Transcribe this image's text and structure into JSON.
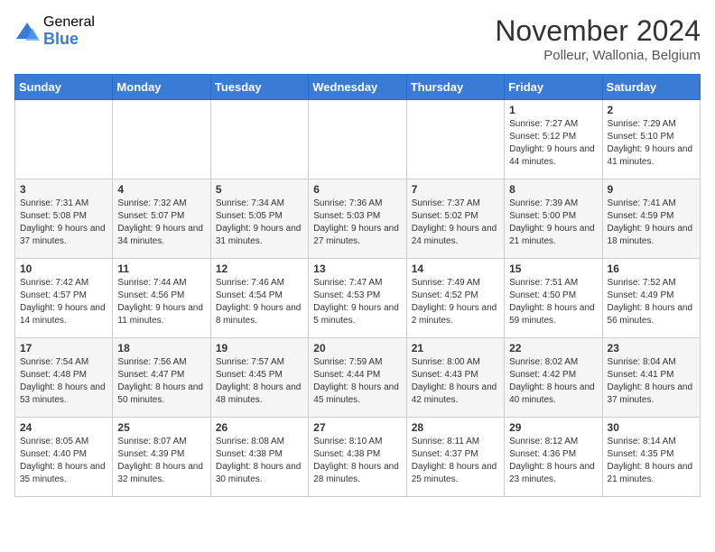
{
  "logo": {
    "general": "General",
    "blue": "Blue"
  },
  "title": "November 2024",
  "location": "Polleur, Wallonia, Belgium",
  "days_of_week": [
    "Sunday",
    "Monday",
    "Tuesday",
    "Wednesday",
    "Thursday",
    "Friday",
    "Saturday"
  ],
  "weeks": [
    [
      {
        "day": "",
        "info": ""
      },
      {
        "day": "",
        "info": ""
      },
      {
        "day": "",
        "info": ""
      },
      {
        "day": "",
        "info": ""
      },
      {
        "day": "",
        "info": ""
      },
      {
        "day": "1",
        "info": "Sunrise: 7:27 AM\nSunset: 5:12 PM\nDaylight: 9 hours and 44 minutes."
      },
      {
        "day": "2",
        "info": "Sunrise: 7:29 AM\nSunset: 5:10 PM\nDaylight: 9 hours and 41 minutes."
      }
    ],
    [
      {
        "day": "3",
        "info": "Sunrise: 7:31 AM\nSunset: 5:08 PM\nDaylight: 9 hours and 37 minutes."
      },
      {
        "day": "4",
        "info": "Sunrise: 7:32 AM\nSunset: 5:07 PM\nDaylight: 9 hours and 34 minutes."
      },
      {
        "day": "5",
        "info": "Sunrise: 7:34 AM\nSunset: 5:05 PM\nDaylight: 9 hours and 31 minutes."
      },
      {
        "day": "6",
        "info": "Sunrise: 7:36 AM\nSunset: 5:03 PM\nDaylight: 9 hours and 27 minutes."
      },
      {
        "day": "7",
        "info": "Sunrise: 7:37 AM\nSunset: 5:02 PM\nDaylight: 9 hours and 24 minutes."
      },
      {
        "day": "8",
        "info": "Sunrise: 7:39 AM\nSunset: 5:00 PM\nDaylight: 9 hours and 21 minutes."
      },
      {
        "day": "9",
        "info": "Sunrise: 7:41 AM\nSunset: 4:59 PM\nDaylight: 9 hours and 18 minutes."
      }
    ],
    [
      {
        "day": "10",
        "info": "Sunrise: 7:42 AM\nSunset: 4:57 PM\nDaylight: 9 hours and 14 minutes."
      },
      {
        "day": "11",
        "info": "Sunrise: 7:44 AM\nSunset: 4:56 PM\nDaylight: 9 hours and 11 minutes."
      },
      {
        "day": "12",
        "info": "Sunrise: 7:46 AM\nSunset: 4:54 PM\nDaylight: 9 hours and 8 minutes."
      },
      {
        "day": "13",
        "info": "Sunrise: 7:47 AM\nSunset: 4:53 PM\nDaylight: 9 hours and 5 minutes."
      },
      {
        "day": "14",
        "info": "Sunrise: 7:49 AM\nSunset: 4:52 PM\nDaylight: 9 hours and 2 minutes."
      },
      {
        "day": "15",
        "info": "Sunrise: 7:51 AM\nSunset: 4:50 PM\nDaylight: 8 hours and 59 minutes."
      },
      {
        "day": "16",
        "info": "Sunrise: 7:52 AM\nSunset: 4:49 PM\nDaylight: 8 hours and 56 minutes."
      }
    ],
    [
      {
        "day": "17",
        "info": "Sunrise: 7:54 AM\nSunset: 4:48 PM\nDaylight: 8 hours and 53 minutes."
      },
      {
        "day": "18",
        "info": "Sunrise: 7:56 AM\nSunset: 4:47 PM\nDaylight: 8 hours and 50 minutes."
      },
      {
        "day": "19",
        "info": "Sunrise: 7:57 AM\nSunset: 4:45 PM\nDaylight: 8 hours and 48 minutes."
      },
      {
        "day": "20",
        "info": "Sunrise: 7:59 AM\nSunset: 4:44 PM\nDaylight: 8 hours and 45 minutes."
      },
      {
        "day": "21",
        "info": "Sunrise: 8:00 AM\nSunset: 4:43 PM\nDaylight: 8 hours and 42 minutes."
      },
      {
        "day": "22",
        "info": "Sunrise: 8:02 AM\nSunset: 4:42 PM\nDaylight: 8 hours and 40 minutes."
      },
      {
        "day": "23",
        "info": "Sunrise: 8:04 AM\nSunset: 4:41 PM\nDaylight: 8 hours and 37 minutes."
      }
    ],
    [
      {
        "day": "24",
        "info": "Sunrise: 8:05 AM\nSunset: 4:40 PM\nDaylight: 8 hours and 35 minutes."
      },
      {
        "day": "25",
        "info": "Sunrise: 8:07 AM\nSunset: 4:39 PM\nDaylight: 8 hours and 32 minutes."
      },
      {
        "day": "26",
        "info": "Sunrise: 8:08 AM\nSunset: 4:38 PM\nDaylight: 8 hours and 30 minutes."
      },
      {
        "day": "27",
        "info": "Sunrise: 8:10 AM\nSunset: 4:38 PM\nDaylight: 8 hours and 28 minutes."
      },
      {
        "day": "28",
        "info": "Sunrise: 8:11 AM\nSunset: 4:37 PM\nDaylight: 8 hours and 25 minutes."
      },
      {
        "day": "29",
        "info": "Sunrise: 8:12 AM\nSunset: 4:36 PM\nDaylight: 8 hours and 23 minutes."
      },
      {
        "day": "30",
        "info": "Sunrise: 8:14 AM\nSunset: 4:35 PM\nDaylight: 8 hours and 21 minutes."
      }
    ]
  ]
}
